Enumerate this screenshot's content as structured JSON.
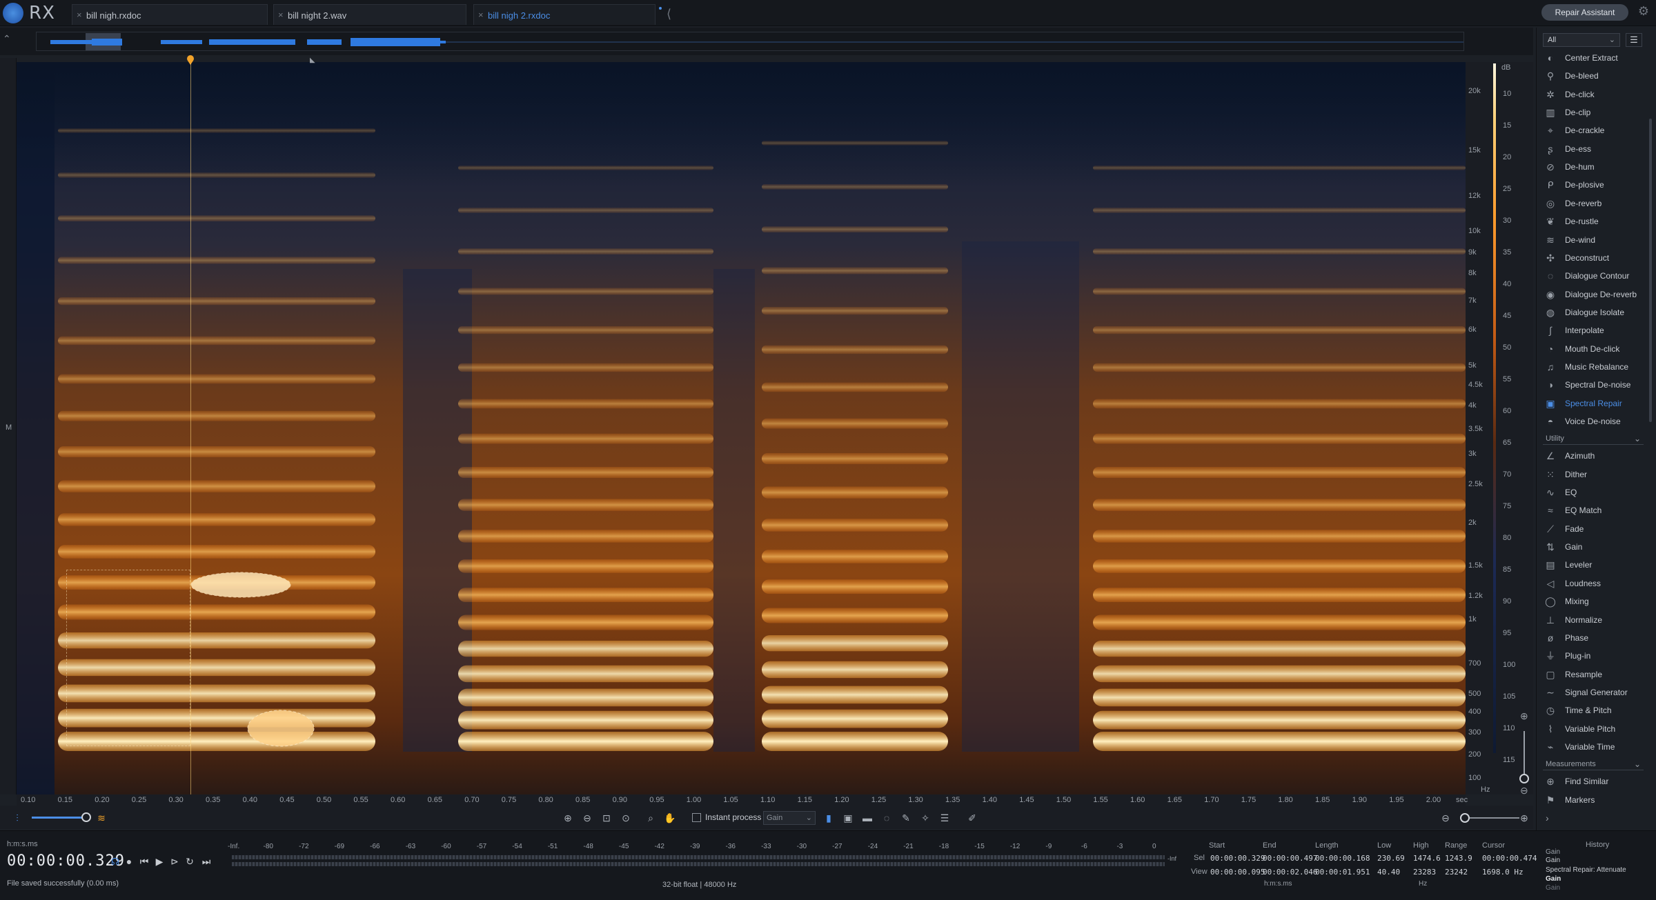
{
  "app": {
    "name": "RX"
  },
  "tabs": [
    {
      "label": "bill nigh.rxdoc",
      "active": false
    },
    {
      "label": "bill night 2.wav",
      "active": false
    },
    {
      "label": "bill nigh 2.rxdoc",
      "active": true
    }
  ],
  "header": {
    "repair_assistant": "Repair Assistant"
  },
  "channel_label": "M",
  "freq_axis": [
    "20k",
    "15k",
    "12k",
    "10k",
    "9k",
    "8k",
    "7k",
    "6k",
    "5k",
    "4.5k",
    "4k",
    "3.5k",
    "3k",
    "2.5k",
    "2k",
    "1.5k",
    "1.2k",
    "1k",
    "700",
    "500",
    "400",
    "300",
    "200",
    "100"
  ],
  "freq_unit": "Hz",
  "db_unit": "dB",
  "db_axis": [
    "10",
    "15",
    "20",
    "25",
    "30",
    "35",
    "40",
    "45",
    "50",
    "55",
    "60",
    "65",
    "70",
    "75",
    "80",
    "85",
    "90",
    "95",
    "100",
    "105",
    "110",
    "115"
  ],
  "time_axis": [
    "0.10",
    "0.15",
    "0.20",
    "0.25",
    "0.30",
    "0.35",
    "0.40",
    "0.45",
    "0.50",
    "0.55",
    "0.60",
    "0.65",
    "0.70",
    "0.75",
    "0.80",
    "0.85",
    "0.90",
    "0.95",
    "1.00",
    "1.05",
    "1.10",
    "1.15",
    "1.20",
    "1.25",
    "1.30",
    "1.35",
    "1.40",
    "1.45",
    "1.50",
    "1.55",
    "1.60",
    "1.65",
    "1.70",
    "1.75",
    "1.80",
    "1.85",
    "1.90",
    "1.95",
    "2.00"
  ],
  "time_unit": "sec",
  "panel": {
    "filter": "All",
    "repair_modules": [
      {
        "label": "Center Extract",
        "icon": "center-extract-icon",
        "glyph": "◐"
      },
      {
        "label": "De-bleed",
        "icon": "de-bleed-icon",
        "glyph": "⚲"
      },
      {
        "label": "De-click",
        "icon": "de-click-icon",
        "glyph": "✲"
      },
      {
        "label": "De-clip",
        "icon": "de-clip-icon",
        "glyph": "▥"
      },
      {
        "label": "De-crackle",
        "icon": "de-crackle-icon",
        "glyph": "⌖"
      },
      {
        "label": "De-ess",
        "icon": "de-ess-icon",
        "glyph": "ʂ"
      },
      {
        "label": "De-hum",
        "icon": "de-hum-icon",
        "glyph": "⊘"
      },
      {
        "label": "De-plosive",
        "icon": "de-plosive-icon",
        "glyph": "ᑭ"
      },
      {
        "label": "De-reverb",
        "icon": "de-reverb-icon",
        "glyph": "◎"
      },
      {
        "label": "De-rustle",
        "icon": "de-rustle-icon",
        "glyph": "❦"
      },
      {
        "label": "De-wind",
        "icon": "de-wind-icon",
        "glyph": "≋"
      },
      {
        "label": "Deconstruct",
        "icon": "deconstruct-icon",
        "glyph": "✣"
      },
      {
        "label": "Dialogue Contour",
        "icon": "dialogue-contour-icon",
        "glyph": "◌"
      },
      {
        "label": "Dialogue De-reverb",
        "icon": "dialogue-de-reverb-icon",
        "glyph": "◉"
      },
      {
        "label": "Dialogue Isolate",
        "icon": "dialogue-isolate-icon",
        "glyph": "◍"
      },
      {
        "label": "Interpolate",
        "icon": "interpolate-icon",
        "glyph": "∫"
      },
      {
        "label": "Mouth De-click",
        "icon": "mouth-de-click-icon",
        "glyph": "◔"
      },
      {
        "label": "Music Rebalance",
        "icon": "music-rebalance-icon",
        "glyph": "♫"
      },
      {
        "label": "Spectral De-noise",
        "icon": "spectral-de-noise-icon",
        "glyph": "◑"
      },
      {
        "label": "Spectral Repair",
        "icon": "spectral-repair-icon",
        "glyph": "▣",
        "active": true
      },
      {
        "label": "Voice De-noise",
        "icon": "voice-de-noise-icon",
        "glyph": "◓"
      }
    ],
    "utility_label": "Utility",
    "utility_modules": [
      {
        "label": "Azimuth",
        "icon": "azimuth-icon",
        "glyph": "∠"
      },
      {
        "label": "Dither",
        "icon": "dither-icon",
        "glyph": "⁙"
      },
      {
        "label": "EQ",
        "icon": "eq-icon",
        "glyph": "∿"
      },
      {
        "label": "EQ Match",
        "icon": "eq-match-icon",
        "glyph": "≈"
      },
      {
        "label": "Fade",
        "icon": "fade-icon",
        "glyph": "⟋"
      },
      {
        "label": "Gain",
        "icon": "gain-icon",
        "glyph": "⇅"
      },
      {
        "label": "Leveler",
        "icon": "leveler-icon",
        "glyph": "▤"
      },
      {
        "label": "Loudness",
        "icon": "loudness-icon",
        "glyph": "◁"
      },
      {
        "label": "Mixing",
        "icon": "mixing-icon",
        "glyph": "◯"
      },
      {
        "label": "Normalize",
        "icon": "normalize-icon",
        "glyph": "⊥"
      },
      {
        "label": "Phase",
        "icon": "phase-icon",
        "glyph": "ø"
      },
      {
        "label": "Plug-in",
        "icon": "plug-in-icon",
        "glyph": "⏚"
      },
      {
        "label": "Resample",
        "icon": "resample-icon",
        "glyph": "▢"
      },
      {
        "label": "Signal Generator",
        "icon": "signal-generator-icon",
        "glyph": "∼"
      },
      {
        "label": "Time & Pitch",
        "icon": "time-pitch-icon",
        "glyph": "◷"
      },
      {
        "label": "Variable Pitch",
        "icon": "variable-pitch-icon",
        "glyph": "⌇"
      },
      {
        "label": "Variable Time",
        "icon": "variable-time-icon",
        "glyph": "⌁"
      }
    ],
    "measurements_label": "Measurements",
    "measurement_modules": [
      {
        "label": "Find Similar",
        "icon": "find-similar-icon",
        "glyph": "⊕"
      },
      {
        "label": "Markers",
        "icon": "markers-icon",
        "glyph": "⚑"
      }
    ]
  },
  "toolbar": {
    "instant_process": "Instant process",
    "gain_select": "Gain"
  },
  "transport": {
    "format": "h:m:s.ms",
    "timecode": "00:00:00.329",
    "status": "File saved successfully (0.00 ms)"
  },
  "meter": {
    "scale": [
      "-Inf.",
      "-80",
      "-72",
      "-69",
      "-66",
      "-63",
      "-60",
      "-57",
      "-54",
      "-51",
      "-48",
      "-45",
      "-42",
      "-39",
      "-36",
      "-33",
      "-30",
      "-27",
      "-24",
      "-21",
      "-18",
      "-15",
      "-12",
      "-9",
      "-6",
      "-3",
      "0"
    ],
    "inf_label": "-Inf",
    "format": "32-bit float | 48000 Hz"
  },
  "selection": {
    "headers": [
      "Start",
      "End",
      "Length",
      "Low",
      "High",
      "Range",
      "Cursor"
    ],
    "rows": [
      {
        "label": "Sel",
        "start": "00:00:00.329",
        "end": "00:00:00.497",
        "length": "00:00:00.168",
        "low": "230.69",
        "high": "1474.6",
        "range": "1243.9",
        "cursor": "00:00:00.474"
      },
      {
        "label": "View",
        "start": "00:00:00.095",
        "end": "00:00:02.046",
        "length": "00:00:01.951",
        "low": "40.40",
        "high": "23283",
        "range": "23242",
        "cursor": "1698.0 Hz"
      }
    ],
    "time_unit": "h:m:s.ms",
    "freq_unit": "Hz"
  },
  "history": {
    "title": "History",
    "items": [
      "Gain",
      "Gain",
      "Spectral Repair: Attenuate",
      "Gain",
      "Gain"
    ]
  },
  "colors": {
    "accent": "#4b8ee6",
    "spectrogram_hot": "#ffb347",
    "spectrogram_cold": "#0a1426"
  }
}
